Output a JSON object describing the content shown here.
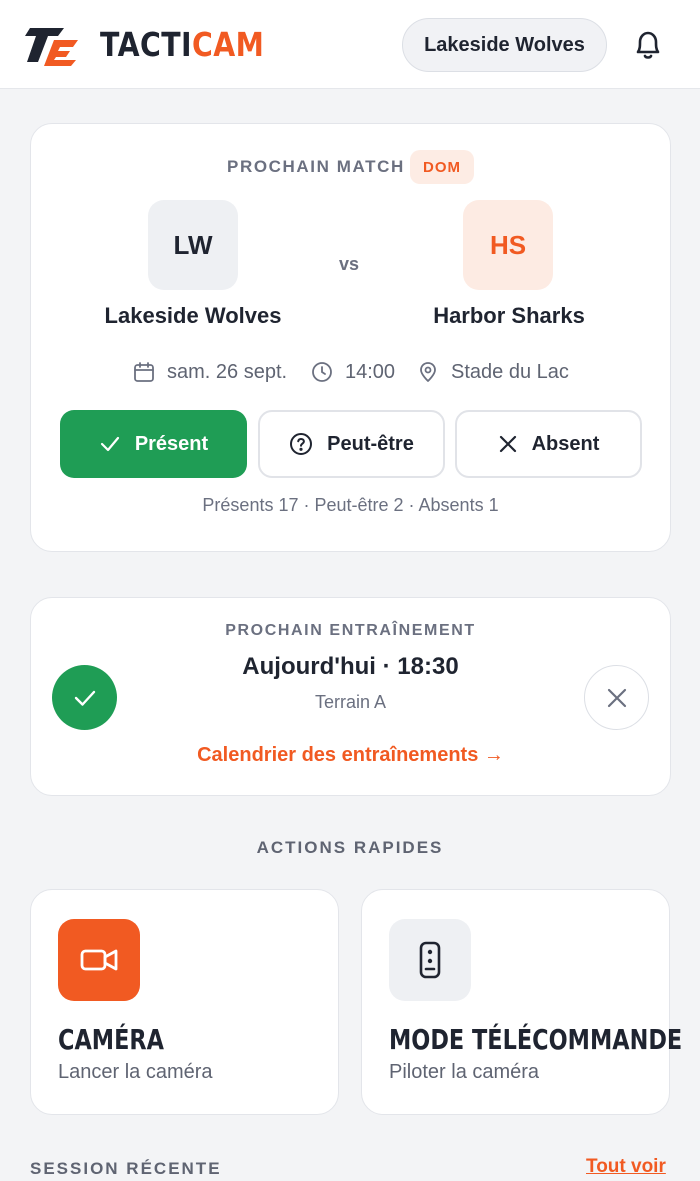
{
  "brand": {
    "name_dark": "TACTI",
    "name_accent": "CAM",
    "accent_color": "#f15a22"
  },
  "header": {
    "team_selector": "Lakeside Wolves",
    "notifications_icon": "bell-icon"
  },
  "next_match": {
    "label": "PROCHAIN MATCH",
    "badge": "DOM",
    "home": {
      "initials": "LW",
      "name": "Lakeside Wolves"
    },
    "vs": "vs",
    "away": {
      "initials": "HS",
      "name": "Harbor Sharks"
    },
    "date": "sam. 26 sept.",
    "time": "14:00",
    "location": "Stade du Lac",
    "rsvp": {
      "present": "Présent",
      "maybe": "Peut-être",
      "absent": "Absent"
    },
    "counts": "Présents 17 · Peut-être 2 · Absents 1"
  },
  "next_training": {
    "label": "PROCHAIN ENTRAÎNEMENT",
    "title": "Aujourd'hui · 18:30",
    "place": "Terrain A",
    "link": "Calendrier des entraînements →"
  },
  "quick_actions": {
    "label": "ACTIONS RAPIDES",
    "camera": {
      "title": "CAMÉRA",
      "subtitle": "Lancer la caméra"
    },
    "remote": {
      "title": "MODE TÉLÉCOMMANDE",
      "subtitle": "Piloter la caméra"
    }
  },
  "recent_session": {
    "label": "SESSION RÉCENTE",
    "see_all": "Tout voir"
  },
  "colors": {
    "accent": "#f15a22",
    "success": "#1f9d55",
    "background": "#f3f4f6"
  }
}
